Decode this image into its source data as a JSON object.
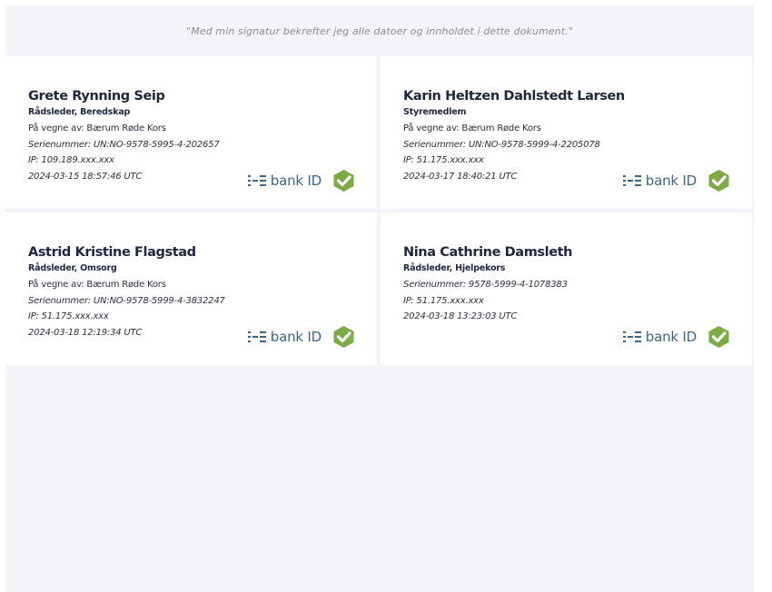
{
  "statement": "\"Med min signatur bekrefter jeg alle datoer og innholdet i dette dokument.\"",
  "brand": {
    "text": "bank ID",
    "icon": "bankid-logo-icon",
    "check_icon": "verified-check-icon",
    "accent": "#7aab45",
    "text_color": "#3e6587"
  },
  "signatures": [
    {
      "name": "Grete Rynning Seip",
      "role": "Rådsleder, Beredskap",
      "on_behalf": "På vegne av: Bærum Røde Kors",
      "serial": "Serienummer: UN:NO-9578-5995-4-202657",
      "ip": "IP: 109.189.xxx.xxx",
      "timestamp": "2024-03-15 18:57:46 UTC"
    },
    {
      "name": "Karin Heltzen Dahlstedt Larsen",
      "role": "Styremedlem",
      "on_behalf": "På vegne av: Bærum Røde Kors",
      "serial": "Serienummer: UN:NO-9578-5999-4-2205078",
      "ip": "IP: 51.175.xxx.xxx",
      "timestamp": "2024-03-17 18:40:21 UTC"
    },
    {
      "name": "Astrid Kristine Flagstad",
      "role": "Rådsleder, Omsorg",
      "on_behalf": "På vegne av: Bærum Røde Kors",
      "serial": "Serienummer: UN:NO-9578-5999-4-3832247",
      "ip": "IP: 51.175.xxx.xxx",
      "timestamp": "2024-03-18 12:19:34 UTC"
    },
    {
      "name": "Nina Cathrine Damsleth",
      "role": "Rådsleder, Hjelpekors",
      "serial": "Serienummer: 9578-5999-4-1078383",
      "ip": "IP: 51.175.xxx.xxx",
      "timestamp": "2024-03-18 13:23:03 UTC"
    }
  ]
}
